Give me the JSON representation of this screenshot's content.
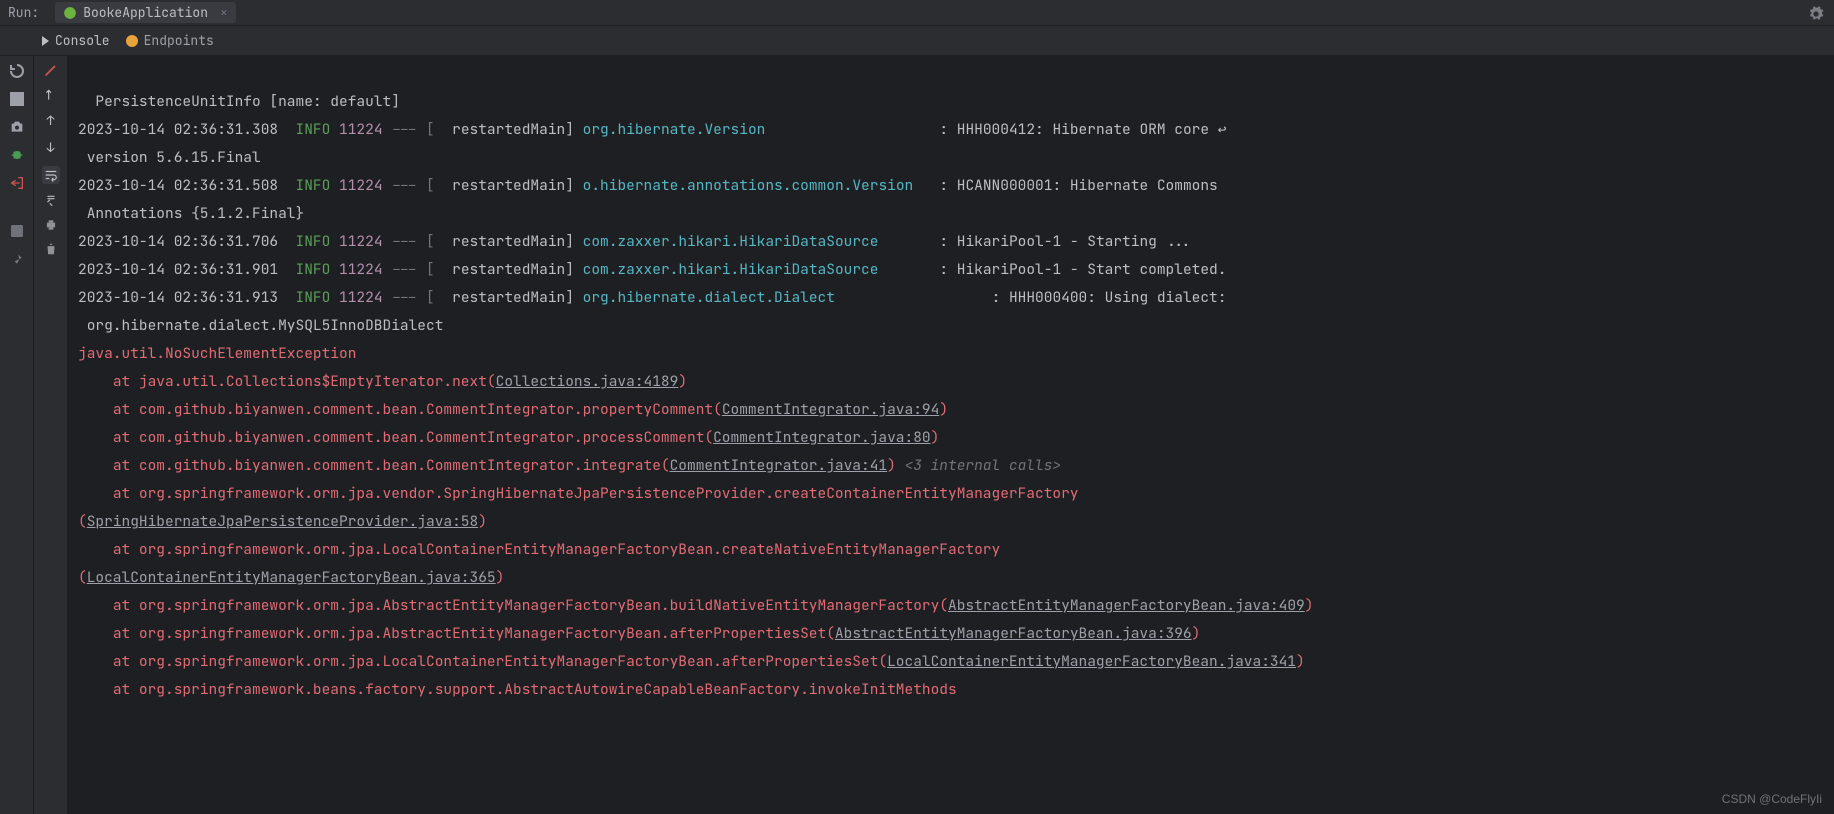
{
  "header": {
    "run_label": "Run:",
    "config_name": "BookeApplication"
  },
  "tabs": {
    "console": "Console",
    "endpoints": "Endpoints"
  },
  "log": {
    "l0": "  PersistenceUnitInfo [name: default]",
    "l1_ts": "2023-10-14 02:36:31.308",
    "l1_level": "INFO",
    "l1_pid": "11224",
    "l1_dash": "--- [",
    "l1_thread": "  restartedMain]",
    "l1_logger": "org.hibernate.Version",
    "l1_msg": ": HHH000412: Hibernate ORM core ",
    "l1b": " version 5.6.15.Final",
    "l2_ts": "2023-10-14 02:36:31.508",
    "l2_level": "INFO",
    "l2_pid": "11224",
    "l2_dash": "--- [",
    "l2_thread": "  restartedMain]",
    "l2_logger": "o.hibernate.annotations.common.Version",
    "l2_msg": ": HCANN000001: Hibernate Commons",
    "l2b": " Annotations {5.1.2.Final}",
    "l3_ts": "2023-10-14 02:36:31.706",
    "l3_level": "INFO",
    "l3_pid": "11224",
    "l3_dash": "--- [",
    "l3_thread": "  restartedMain]",
    "l3_logger": "com.zaxxer.hikari.HikariDataSource",
    "l3_msg": ": HikariPool-1 - Starting ...",
    "l4_ts": "2023-10-14 02:36:31.901",
    "l4_level": "INFO",
    "l4_pid": "11224",
    "l4_dash": "--- [",
    "l4_thread": "  restartedMain]",
    "l4_logger": "com.zaxxer.hikari.HikariDataSource",
    "l4_msg": ": HikariPool-1 - Start completed.",
    "l5_ts": "2023-10-14 02:36:31.913",
    "l5_level": "INFO",
    "l5_pid": "11224",
    "l5_dash": "--- [",
    "l5_thread": "  restartedMain]",
    "l5_logger": "org.hibernate.dialect.Dialect",
    "l5_msg": ": HHH000400: Using dialect:",
    "l5b": " org.hibernate.dialect.MySQL5InnoDBDialect",
    "ex": "java.util.NoSuchElementException",
    "at1a": "    at java.util.Collections$EmptyIterator.next(",
    "at1b": "Collections.java:4189",
    "at1c": ")",
    "at2a": "    at com.github.biyanwen.comment.bean.CommentIntegrator.propertyComment(",
    "at2b": "CommentIntegrator.java:94",
    "at2c": ")",
    "at3a": "    at com.github.biyanwen.comment.bean.CommentIntegrator.processComment(",
    "at3b": "CommentIntegrator.java:80",
    "at3c": ")",
    "at4a": "    at com.github.biyanwen.comment.bean.CommentIntegrator.integrate(",
    "at4b": "CommentIntegrator.java:41",
    "at4c": ")",
    "at4hint": " <3 internal calls>",
    "at5a": "    at org.springframework.orm.jpa.vendor.SpringHibernateJpaPersistenceProvider.createContainerEntityManagerFactory",
    "at5b_open": "(",
    "at5b": "SpringHibernateJpaPersistenceProvider.java:58",
    "at5c": ")",
    "at6a": "    at org.springframework.orm.jpa.LocalContainerEntityManagerFactoryBean.createNativeEntityManagerFactory",
    "at6b_open": "(",
    "at6b": "LocalContainerEntityManagerFactoryBean.java:365",
    "at6c": ")",
    "at7a": "    at org.springframework.orm.jpa.AbstractEntityManagerFactoryBean.buildNativeEntityManagerFactory(",
    "at7b": "AbstractEntityManagerFactoryBean.java:409",
    "at7c": ")",
    "at8a": "    at org.springframework.orm.jpa.AbstractEntityManagerFactoryBean.afterPropertiesSet(",
    "at8b": "AbstractEntityManagerFactoryBean.java:396",
    "at8c": ")",
    "at9a": "    at org.springframework.orm.jpa.LocalContainerEntityManagerFactoryBean.afterPropertiesSet(",
    "at9b": "LocalContainerEntityManagerFactoryBean.java:341",
    "at9c": ")",
    "at10": "    at org.springframework.beans.factory.support.AbstractAutowireCapableBeanFactory.invokeInitMethods"
  },
  "watermark": "CSDN @CodeFlyIi"
}
